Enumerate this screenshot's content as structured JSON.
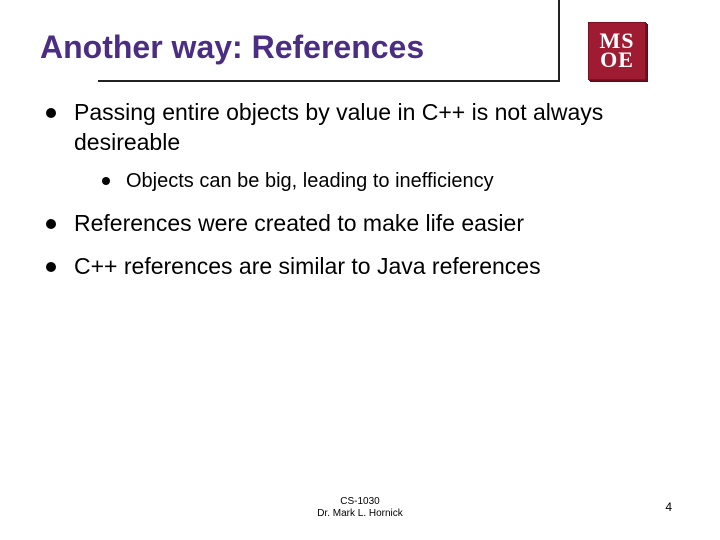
{
  "logo": {
    "line1": "MS",
    "line2": "OE"
  },
  "title": "Another way: References",
  "bullets": [
    {
      "text": "Passing entire objects by value in C++ is not always desireable",
      "sub": [
        {
          "text": "Objects can be big, leading to inefficiency"
        }
      ]
    },
    {
      "text": "References were created to make life easier"
    },
    {
      "text": "C++ references are similar to Java references"
    }
  ],
  "footer": {
    "course": "CS-1030",
    "author": "Dr. Mark L. Hornick"
  },
  "page_number": "4"
}
